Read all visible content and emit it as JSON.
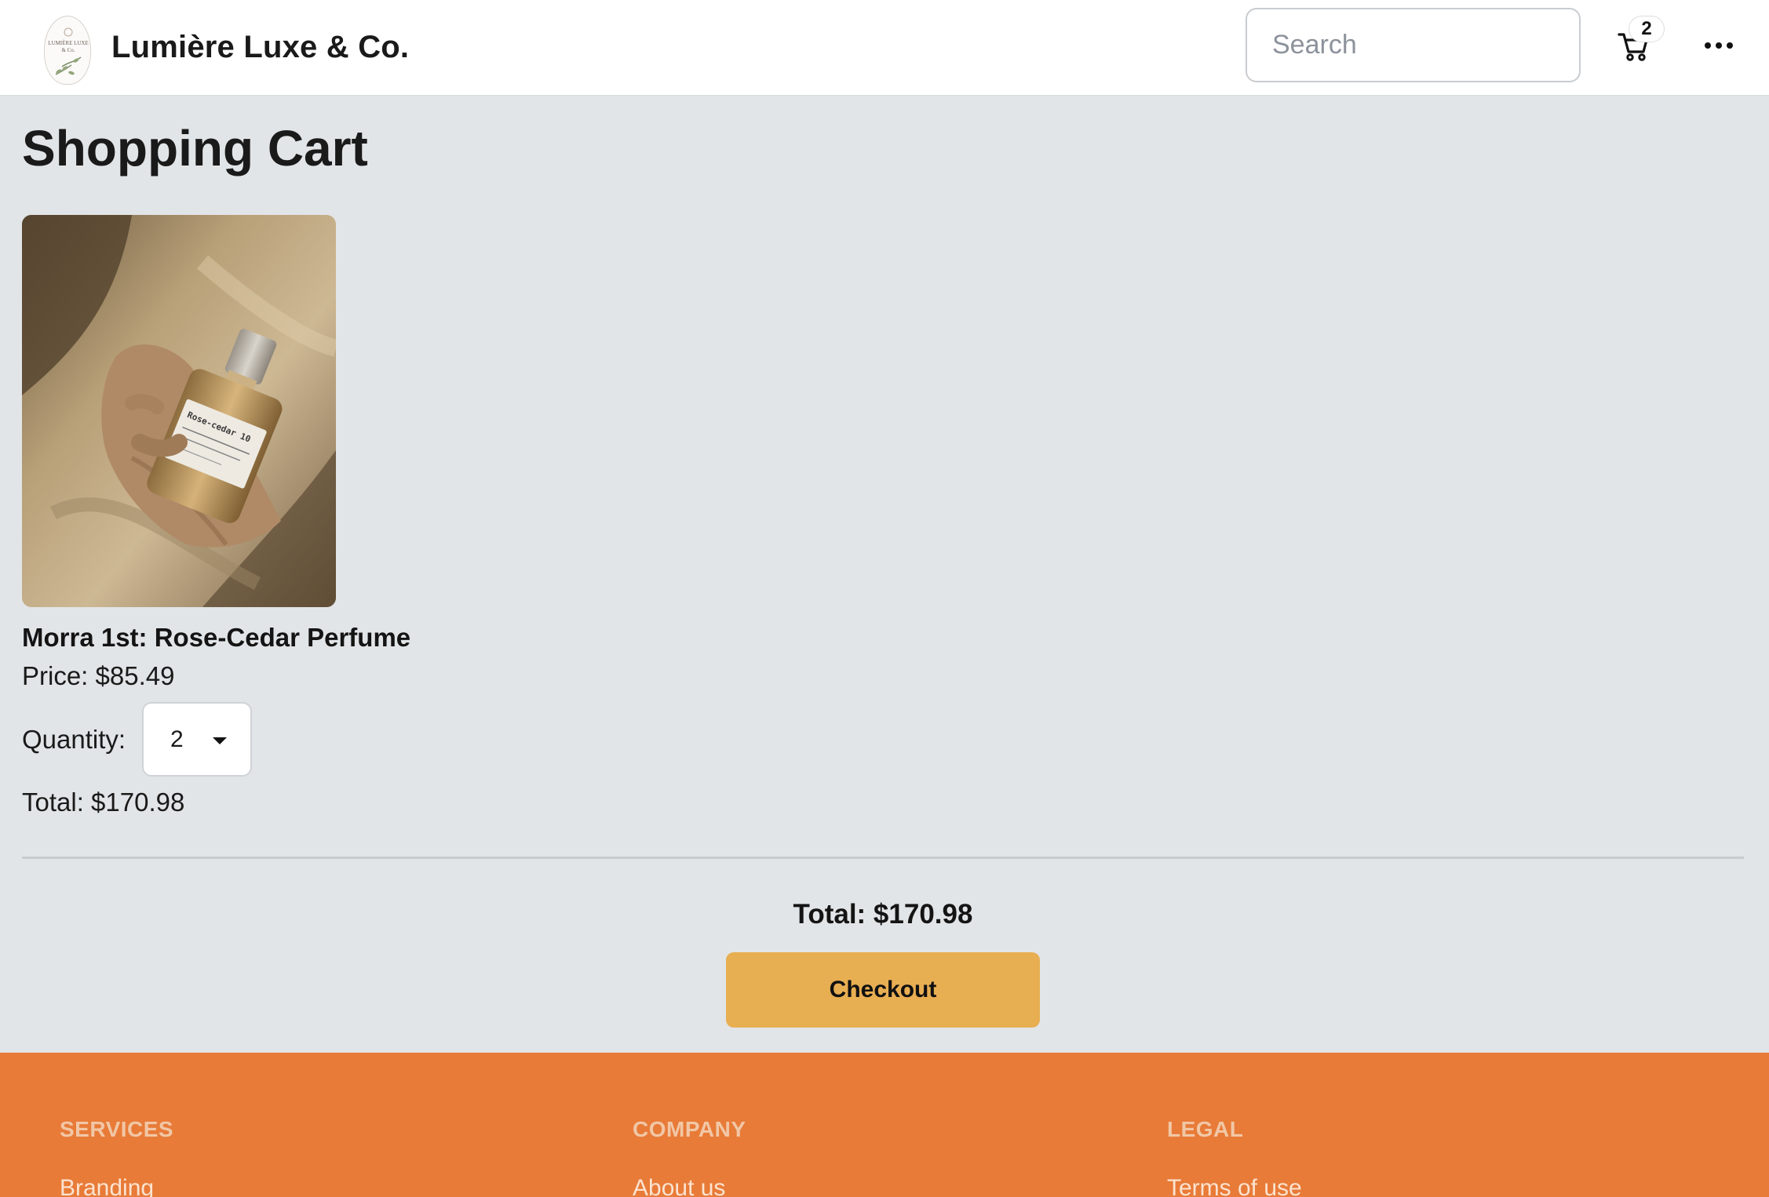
{
  "header": {
    "brand_name": "Lumière Luxe & Co.",
    "logo_text": "LUMIÈRE LUXE & Co.",
    "search_placeholder": "Search",
    "cart_count": "2",
    "icons": [
      "logo-icon",
      "cart-icon",
      "more-icon"
    ]
  },
  "main": {
    "title": "Shopping Cart",
    "cart_item": {
      "image_label": "Rose-cedar 10",
      "name": "Morra 1st: Rose-Cedar Perfume",
      "price_text": "Price: $85.49",
      "quantity_label": "Quantity:",
      "quantity_value": "2",
      "total_text": "Total: $170.98"
    },
    "grand_total_text": "Total: $170.98",
    "checkout_label": "Checkout"
  },
  "footer": {
    "columns": [
      {
        "heading": "SERVICES",
        "first_link": "Branding"
      },
      {
        "heading": "COMPANY",
        "first_link": "About us"
      },
      {
        "heading": "LEGAL",
        "first_link": "Terms of use"
      }
    ]
  },
  "colors": {
    "page_background": "#e2e5e7",
    "header_background": "#ffffff",
    "checkout_button": "#e8ae52",
    "footer_background": "#e87b38",
    "footer_heading": "#f1c7a6"
  }
}
